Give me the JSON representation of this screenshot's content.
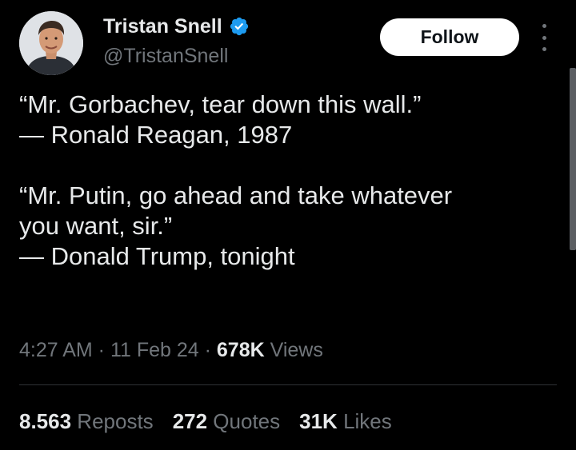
{
  "author": {
    "display_name": "Tristan Snell",
    "handle": "@TristanSnell",
    "verified_icon": "verified-badge-icon",
    "verified_color": "#1d9bf0"
  },
  "actions": {
    "follow_label": "Follow",
    "more_icon": "more-vertical-icon"
  },
  "tweet": {
    "lines": [
      "“Mr. Gorbachev, tear down this wall.”",
      "— Ronald Reagan, 1987",
      "",
      "“Mr. Putin, go ahead and take whatever",
      "you want, sir.”",
      "— Donald Trump, tonight"
    ]
  },
  "meta": {
    "time": "4:27 AM",
    "separator": " · ",
    "date": "11 Feb 24",
    "views_count": "678K",
    "views_label": " Views"
  },
  "stats": {
    "reposts_count": "8.563",
    "reposts_label": " Reposts",
    "quotes_count": "272",
    "quotes_label": " Quotes",
    "likes_count": "31K",
    "likes_label": " Likes"
  },
  "colors": {
    "background": "#000000",
    "primary_text": "#e7e9ea",
    "secondary_text": "#71767b",
    "follow_button_bg": "#ffffff",
    "divider": "#2f3336"
  }
}
